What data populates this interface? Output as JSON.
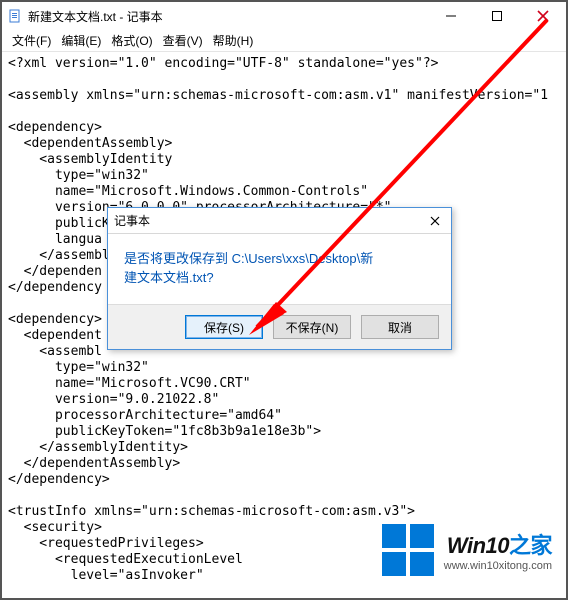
{
  "window": {
    "title": "新建文本文档.txt - 记事本"
  },
  "menu": {
    "file": "文件(F)",
    "edit": "编辑(E)",
    "format": "格式(O)",
    "view": "查看(V)",
    "help": "帮助(H)"
  },
  "dialog": {
    "title": "记事本",
    "message_l1": "是否将更改保存到 C:\\Users\\xxs\\Desktop\\新",
    "message_l2": "建文本文档.txt?",
    "save": "保存(S)",
    "dontsave": "不保存(N)",
    "cancel": "取消"
  },
  "document": {
    "line1": "<?xml version=\"1.0\" encoding=\"UTF-8\" standalone=\"yes\"?>",
    "line2": "",
    "line3": "<assembly xmlns=\"urn:schemas-microsoft-com:asm.v1\" manifestVersion=\"1",
    "line4": "",
    "line5": "<dependency>",
    "line6": "  <dependentAssembly>",
    "line7": "    <assemblyIdentity",
    "line8": "      type=\"win32\"",
    "line9": "      name=\"Microsoft.Windows.Common-Controls\"",
    "line10": "      version=\"6.0.0.0\" processorArchitecture=\"*\"",
    "line11": "      publicK",
    "line12": "      langua",
    "line13": "    </assembl",
    "line14": "  </dependen",
    "line15": "</dependency",
    "line16": "",
    "line17": "<dependency>",
    "line18": "  <dependent",
    "line19": "    <assembl",
    "line20": "      type=\"win32\"",
    "line21": "      name=\"Microsoft.VC90.CRT\"",
    "line22": "      version=\"9.0.21022.8\"",
    "line23": "      processorArchitecture=\"amd64\"",
    "line24": "      publicKeyToken=\"1fc8b3b9a1e18e3b\">",
    "line25": "    </assemblyIdentity>",
    "line26": "  </dependentAssembly>",
    "line27": "</dependency>",
    "line28": "",
    "line29": "<trustInfo xmlns=\"urn:schemas-microsoft-com:asm.v3\">",
    "line30": "  <security>",
    "line31": "    <requestedPrivileges>",
    "line32": "      <requestedExecutionLevel",
    "line33": "        level=\"asInvoker\""
  },
  "watermark": {
    "brand_a": "Win10",
    "brand_b": "之家",
    "url": "www.win10xitong.com"
  }
}
